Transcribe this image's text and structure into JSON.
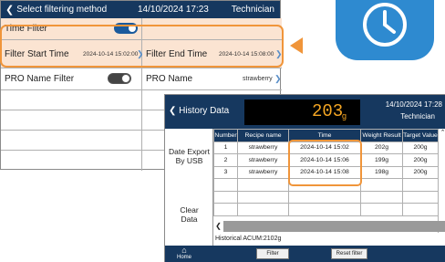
{
  "filter_screen": {
    "header": {
      "back_label": "Select filtering method",
      "datetime": "14/10/2024 17:23",
      "role": "Technician"
    },
    "time_filter": {
      "label": "Time Filter",
      "enabled": true
    },
    "filter_start": {
      "label": "Filter Start Time",
      "value": "2024-10-14 15:02:00"
    },
    "filter_end": {
      "label": "Filter End Time",
      "value": "2024-10-14 15:08:00"
    },
    "pro_name_filter": {
      "label": "PRO Name Filter",
      "enabled": false
    },
    "pro_name": {
      "label": "PRO Name",
      "value": "strawberry"
    }
  },
  "history_screen": {
    "header": {
      "title": "History Data",
      "weight_display": "203",
      "weight_unit": "g",
      "datetime": "14/10/2024 17:28",
      "role": "Technician"
    },
    "side_buttons": {
      "export": "Date Export By USB",
      "clear": "Clear Data"
    },
    "table": {
      "columns": [
        "Number",
        "Recipe name",
        "Time",
        "Weight Result",
        "Target Value"
      ],
      "rows": [
        [
          "1",
          "strawberry",
          "2024-10-14 15:02",
          "202g",
          "200g"
        ],
        [
          "2",
          "strawberry",
          "2024-10-14 15:06",
          "199g",
          "200g"
        ],
        [
          "3",
          "strawberry",
          "2024-10-14 15:08",
          "198g",
          "200g"
        ]
      ]
    },
    "accum": "Historical ACUM:2102g",
    "bottom": {
      "home": "Home",
      "filter": "Filter",
      "reset_filter": "Reset filter"
    }
  },
  "colors": {
    "navy": "#16385f",
    "highlight": "#f0953a",
    "peach": "#fbe4d2",
    "clock_blue": "#2e8ad0",
    "lcd_digits": "#f5a623"
  },
  "icons": [
    "chevron-left-icon",
    "toggle-switch",
    "chevron-right-icon",
    "clock-icon",
    "arrow-left-icon",
    "home-icon",
    "scroll-up-icon",
    "scroll-left-icon",
    "scroll-right-icon"
  ]
}
